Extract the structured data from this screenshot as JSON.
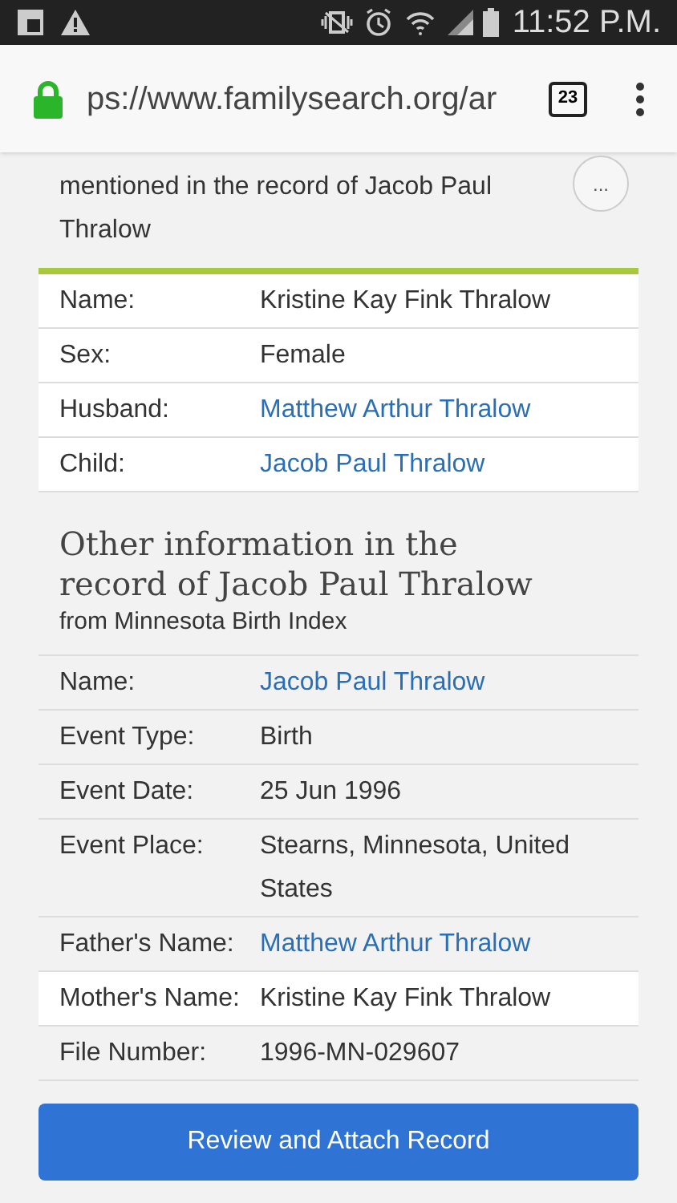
{
  "status_bar": {
    "time": "11:52 P.M."
  },
  "address_bar": {
    "url": "ps://www.familysearch.org/ar",
    "tab_count": "23"
  },
  "person_card": {
    "subtitle": "mentioned in the record of Jacob Paul Thralow",
    "more_button": "..."
  },
  "person_table": [
    {
      "label": "Name:",
      "value": "Kristine Kay Fink Thralow",
      "kind": "text"
    },
    {
      "label": "Sex:",
      "value": "Female",
      "kind": "text"
    },
    {
      "label": "Husband:",
      "value": "Matthew Arthur Thralow",
      "kind": "link"
    },
    {
      "label": "Child:",
      "value": "Jacob Paul Thralow",
      "kind": "link"
    }
  ],
  "other_info": {
    "heading": "Other information in the record of Jacob Paul Thralow",
    "source": "from Minnesota Birth Index"
  },
  "record_table": [
    {
      "label": "Name:",
      "value": "Jacob Paul Thralow",
      "kind": "link",
      "highlighted": false
    },
    {
      "label": "Event Type:",
      "value": "Birth",
      "kind": "text",
      "highlighted": false
    },
    {
      "label": "Event Date:",
      "value": "25 Jun 1996",
      "kind": "text",
      "highlighted": false
    },
    {
      "label": "Event Place:",
      "value": "Stearns, Minnesota, United States",
      "kind": "text",
      "highlighted": false
    },
    {
      "label": "Father's Name:",
      "value": "Matthew Arthur Thralow",
      "kind": "link",
      "highlighted": false
    },
    {
      "label": "Mother's Name:",
      "value": "Kristine Kay Fink Thralow",
      "kind": "text",
      "highlighted": true
    },
    {
      "label": "File Number:",
      "value": "1996-MN-029607",
      "kind": "text",
      "highlighted": false
    }
  ],
  "primary_button": "Review and Attach Record"
}
